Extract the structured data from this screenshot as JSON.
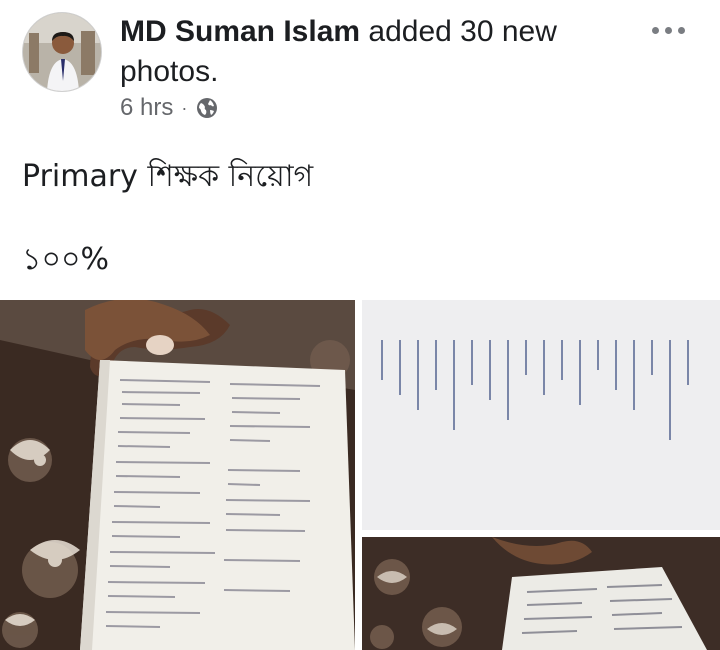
{
  "post": {
    "author": "MD Suman Islam",
    "action": "added 30 new photos.",
    "time": "6 hrs",
    "separator": "·",
    "audience_icon": "globe-icon",
    "more_icon": "more-options-icon",
    "text_line1": "Primary শিক্ষক নিয়োগ",
    "text_line2": "১০০%"
  },
  "photos": {
    "count_shown": 3,
    "items": [
      {
        "label": "question-paper-photo-1"
      },
      {
        "label": "question-paper-photo-2"
      },
      {
        "label": "question-paper-photo-3"
      }
    ]
  },
  "colors": {
    "meta_gray": "#65676b",
    "text": "#1c1e21"
  }
}
